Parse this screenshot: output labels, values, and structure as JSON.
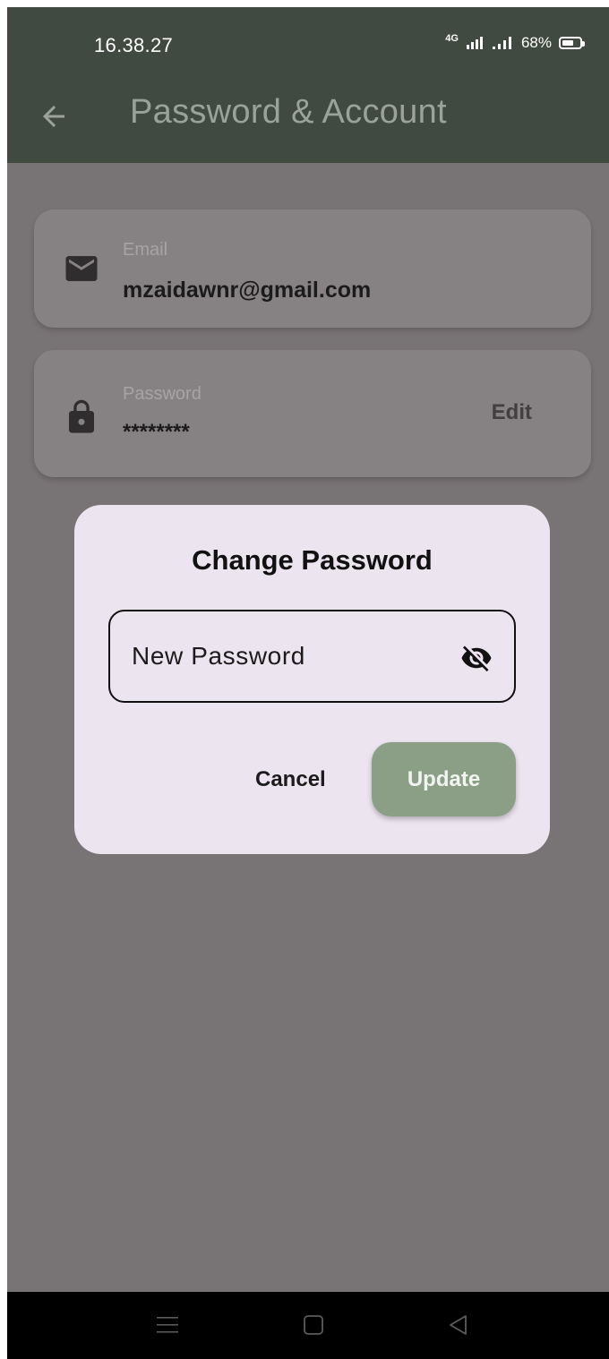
{
  "status_bar": {
    "time": "16.38.27",
    "network": "4G",
    "battery_percent": "68%",
    "battery_level": 0.68
  },
  "app_bar": {
    "title": "Password & Account"
  },
  "email_card": {
    "label": "Email",
    "value": "mzaidawnr@gmail.com"
  },
  "password_card": {
    "label": "Password",
    "value": "********",
    "edit_label": "Edit"
  },
  "dialog": {
    "title": "Change Password",
    "field_placeholder": "New Password",
    "cancel_label": "Cancel",
    "update_label": "Update"
  },
  "colors": {
    "app_bar": "#414a41",
    "scrim": "#787375",
    "dialog_bg": "#ece4ef",
    "update_button": "#8b9f87"
  },
  "icons": {
    "back": "arrow-left-icon",
    "email": "mail-icon",
    "password": "lock-icon",
    "visibility": "eye-off-icon",
    "nav_menu": "menu-icon",
    "nav_home": "square-icon",
    "nav_back": "triangle-back-icon"
  }
}
